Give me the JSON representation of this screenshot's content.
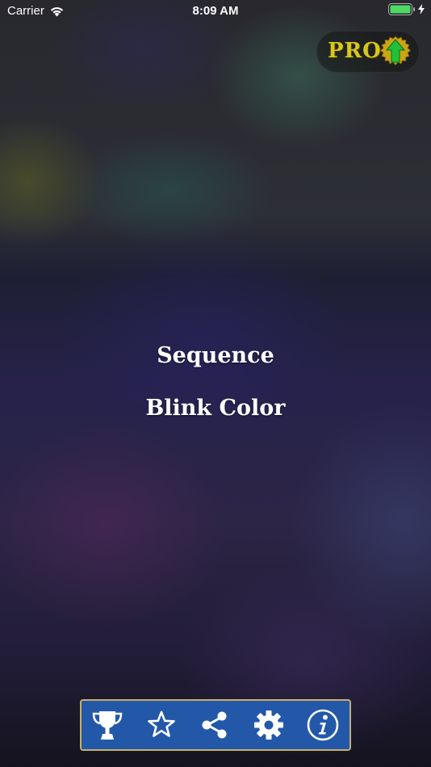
{
  "status_bar": {
    "carrier": "Carrier",
    "time": "8:09 AM"
  },
  "pro_badge": {
    "label": "PRO",
    "label_color": "#d8c61c",
    "arrow_color": "#22c03a"
  },
  "menu": {
    "items": [
      "Sequence",
      "Blink Color"
    ]
  },
  "toolbar": {
    "background_color": "#2358a9",
    "border_color": "#c8b06a",
    "icons": [
      "trophy-icon",
      "star-icon",
      "share-icon",
      "gear-icon",
      "info-icon"
    ]
  },
  "colors": {
    "battery": "#4cd964"
  }
}
